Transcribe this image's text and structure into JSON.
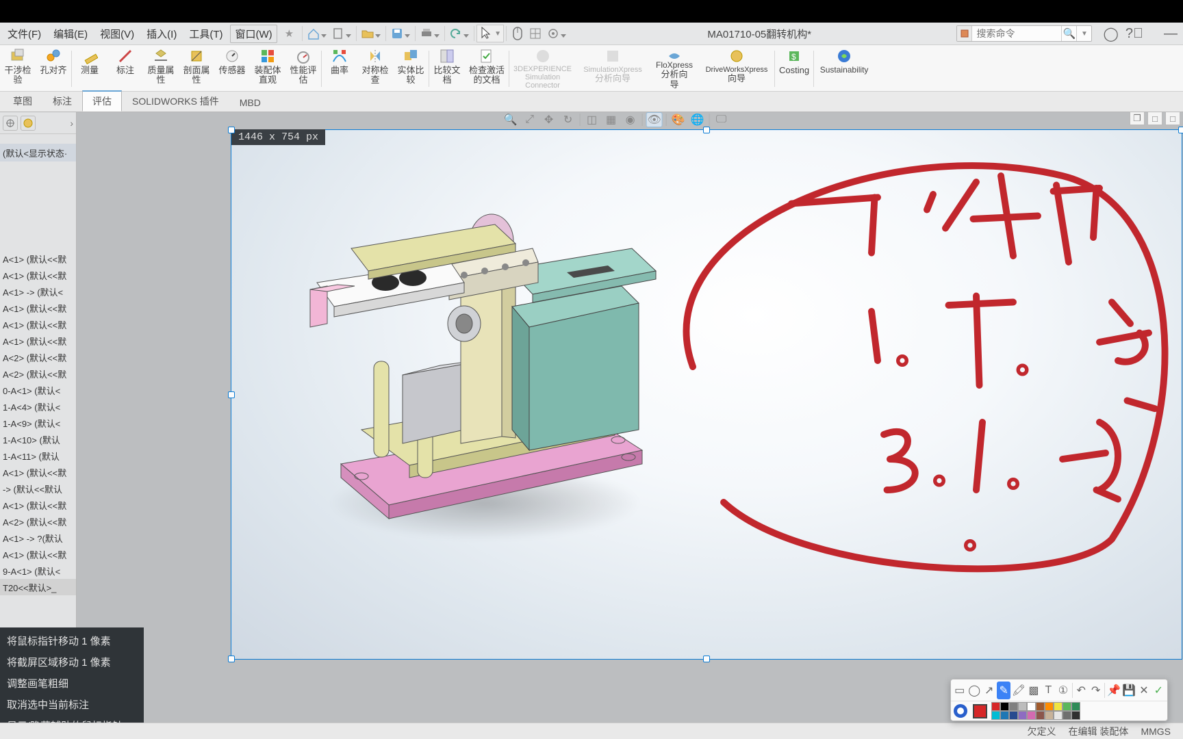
{
  "menu": {
    "file": "文件(F)",
    "edit": "编辑(E)",
    "view": "视图(V)",
    "insert": "插入(I)",
    "tools": "工具(T)",
    "window": "窗口(W)",
    "pin": "★"
  },
  "doc_title": "MA01710-05翻转机构*",
  "search": {
    "placeholder": "搜索命令"
  },
  "ribbon": [
    {
      "k": "inspect",
      "l1": "干涉检",
      "l2": "验"
    },
    {
      "k": "hole",
      "l1": "孔对齐"
    },
    {
      "k": "measure",
      "l1": "测量"
    },
    {
      "k": "markup",
      "l1": "标注"
    },
    {
      "k": "massprops",
      "l1": "质量属",
      "l2": "性"
    },
    {
      "k": "section",
      "l1": "剖面属",
      "l2": "性"
    },
    {
      "k": "sensor",
      "l1": "传感器"
    },
    {
      "k": "asmvis",
      "l1": "装配体",
      "l2": "直观"
    },
    {
      "k": "perfeval",
      "l1": "性能评",
      "l2": "估"
    },
    {
      "k": "curvature",
      "l1": "曲率"
    },
    {
      "k": "symcheck",
      "l1": "对称检",
      "l2": "查"
    },
    {
      "k": "compare",
      "l1": "实体比",
      "l2": "较"
    },
    {
      "k": "compdoc",
      "l1": "比较文",
      "l2": "档"
    },
    {
      "k": "chkactive",
      "l1": "检查激活",
      "l2": "的文档"
    },
    {
      "k": "3dx",
      "l1": "3DEXPERIENCE",
      "l2": "Simulation",
      "l3": "Connector"
    },
    {
      "k": "simx",
      "l1": "SimulationXpress",
      "l2": "分析向导"
    },
    {
      "k": "flox",
      "l1": "FloXpress",
      "l2": "分析向",
      "l3": "导"
    },
    {
      "k": "drvw",
      "l1": "DriveWorksXpress",
      "l2": "向导"
    },
    {
      "k": "costing",
      "l1": "Costing"
    },
    {
      "k": "sustain",
      "l1": "Sustainability"
    }
  ],
  "tabs": [
    "草图",
    "标注",
    "评估",
    "SOLIDWORKS 插件",
    "MBD"
  ],
  "active_tab": 2,
  "tree_top": "(默认<显示状态·",
  "tree": [
    "A<1> (默认<<默",
    "A<1> (默认<<默",
    "A<1> -> (默认<",
    "A<1> (默认<<默",
    "A<1> (默认<<默",
    "A<1> (默认<<默",
    "A<2> (默认<<默",
    "A<2> (默认<<默",
    "0-A<1> (默认<",
    "1-A<4> (默认<",
    "1-A<9> (默认<",
    "1-A<10> (默认",
    "1-A<11> (默认",
    "A<1> (默认<<默",
    "-> (默认<<默认",
    "A<1> (默认<<默",
    "A<2> (默认<<默",
    "A<1> -> ?(默认",
    "A<1> (默认<<默",
    "9-A<1> (默认<",
    "T20<<默认>_"
  ],
  "dim_label": "1446 x 754 px",
  "help": [
    "将鼠标指针移动 1 像素",
    "将截屏区域移动 1 像素",
    "调整画笔粗细",
    "取消选中当前标注",
    "显示/隐藏辅助的鼠标指针"
  ],
  "status": {
    "a": "欠定义",
    "b": "在编辑 装配体",
    "c": "MMGS"
  },
  "swatches": [
    "#d62728",
    "#000000",
    "#7f7f7f",
    "#bcbcbc",
    "#ffffff",
    "#a05a2c",
    "#ff8c00",
    "#f0e442",
    "#5bb75b",
    "#2e8b57",
    "#00bcd4",
    "#1f77b4",
    "#274b8f",
    "#8e6cc1",
    "#d36bb0",
    "#8c564b",
    "#c7b299",
    "#e6e6e6",
    "#6f6f6f",
    "#303030"
  ]
}
